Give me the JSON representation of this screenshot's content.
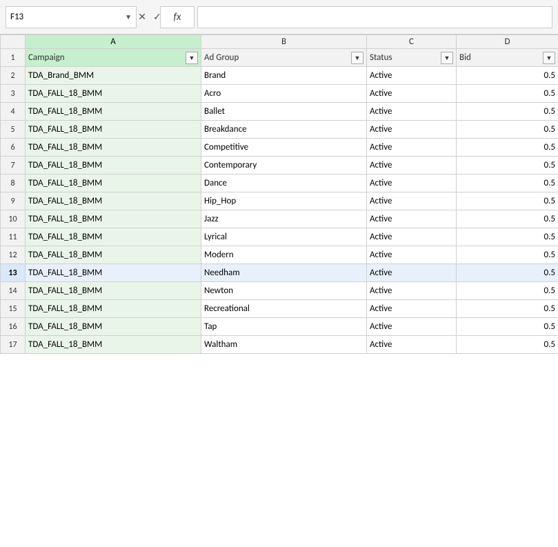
{
  "formula_bar": {
    "cell_ref": "F13",
    "cancel_label": "✕",
    "confirm_label": "✓",
    "fx_label": "fx",
    "formula_value": ""
  },
  "columns": {
    "row_num": "",
    "A": "A",
    "B": "B",
    "C": "C",
    "D": "D"
  },
  "headers": {
    "campaign": "Campaign",
    "ad_group": "Ad Group",
    "status": "Status",
    "bid": "Bid"
  },
  "rows": [
    {
      "num": "2",
      "campaign": "TDA_Brand_BMM",
      "ad_group": "Brand",
      "status": "Active",
      "bid": "0.5"
    },
    {
      "num": "3",
      "campaign": "TDA_FALL_18_BMM",
      "ad_group": "Acro",
      "status": "Active",
      "bid": "0.5"
    },
    {
      "num": "4",
      "campaign": "TDA_FALL_18_BMM",
      "ad_group": "Ballet",
      "status": "Active",
      "bid": "0.5"
    },
    {
      "num": "5",
      "campaign": "TDA_FALL_18_BMM",
      "ad_group": "Breakdance",
      "status": "Active",
      "bid": "0.5"
    },
    {
      "num": "6",
      "campaign": "TDA_FALL_18_BMM",
      "ad_group": "Competitive",
      "status": "Active",
      "bid": "0.5"
    },
    {
      "num": "7",
      "campaign": "TDA_FALL_18_BMM",
      "ad_group": "Contemporary",
      "status": "Active",
      "bid": "0.5"
    },
    {
      "num": "8",
      "campaign": "TDA_FALL_18_BMM",
      "ad_group": "Dance",
      "status": "Active",
      "bid": "0.5"
    },
    {
      "num": "9",
      "campaign": "TDA_FALL_18_BMM",
      "ad_group": "Hip_Hop",
      "status": "Active",
      "bid": "0.5"
    },
    {
      "num": "10",
      "campaign": "TDA_FALL_18_BMM",
      "ad_group": "Jazz",
      "status": "Active",
      "bid": "0.5"
    },
    {
      "num": "11",
      "campaign": "TDA_FALL_18_BMM",
      "ad_group": "Lyrical",
      "status": "Active",
      "bid": "0.5"
    },
    {
      "num": "12",
      "campaign": "TDA_FALL_18_BMM",
      "ad_group": "Modern",
      "status": "Active",
      "bid": "0.5"
    },
    {
      "num": "13",
      "campaign": "TDA_FALL_18_BMM",
      "ad_group": "Needham",
      "status": "Active",
      "bid": "0.5",
      "selected": true
    },
    {
      "num": "14",
      "campaign": "TDA_FALL_18_BMM",
      "ad_group": "Newton",
      "status": "Active",
      "bid": "0.5"
    },
    {
      "num": "15",
      "campaign": "TDA_FALL_18_BMM",
      "ad_group": "Recreational",
      "status": "Active",
      "bid": "0.5"
    },
    {
      "num": "16",
      "campaign": "TDA_FALL_18_BMM",
      "ad_group": "Tap",
      "status": "Active",
      "bid": "0.5"
    },
    {
      "num": "17",
      "campaign": "TDA_FALL_18_BMM",
      "ad_group": "Waltham",
      "status": "Active",
      "bid": "0.5"
    }
  ]
}
